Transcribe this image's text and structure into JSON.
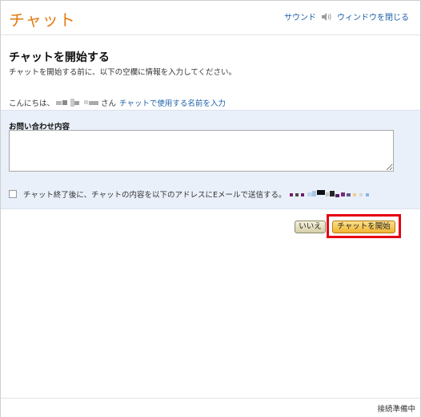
{
  "header": {
    "title": "チャット",
    "sound_label": "サウンド",
    "close_label": "ウィンドウを閉じる"
  },
  "section": {
    "title": "チャットを開始する",
    "description": "チャットを開始する前に、以下の空欄に情報を入力してください。"
  },
  "greeting": {
    "prefix": "こんにちは、",
    "suffix": "さん",
    "link": "チャットで使用する名前を入力"
  },
  "inquiry": {
    "label": "お問い合わせ内容",
    "value": ""
  },
  "email_option": {
    "label": "チャット終了後に、チャットの内容を以下のアドレスにEメールで送信する。"
  },
  "buttons": {
    "no": "いいえ",
    "start": "チャットを開始"
  },
  "status": "接続準備中",
  "colors": {
    "brand": "#e47911",
    "link": "#1c5fa8",
    "highlight": "#e60012",
    "panel": "#eaf0fa"
  },
  "icons": {
    "sound": "speaker-icon"
  }
}
